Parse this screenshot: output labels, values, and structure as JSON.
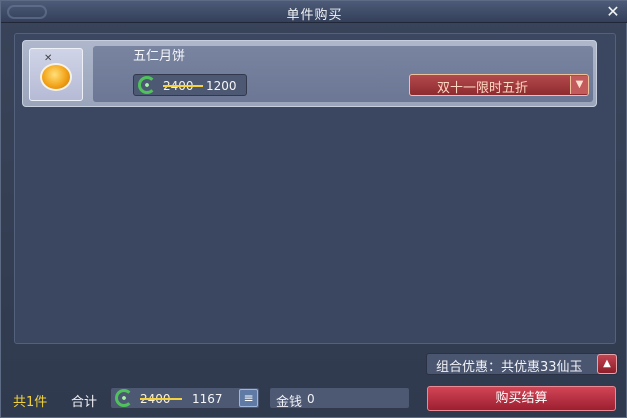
{
  "window": {
    "title": "单件购买"
  },
  "item": {
    "name": "五仁月饼",
    "icon": "mooncake-icon",
    "currency_icon": "jade-icon",
    "original_price": "2400",
    "sale_price": "1200",
    "promo_label": "双十一限时五折"
  },
  "combo": {
    "label": "组合优惠：共优惠33仙玉"
  },
  "footer": {
    "count_label": "共1件",
    "total_label": "合计",
    "total_original": "2400",
    "total_value": "1167",
    "money_label": "金钱",
    "money_value": "0",
    "checkout_label": "购买结算"
  },
  "colors": {
    "accent_red": "#b8333f",
    "count_yellow": "#f2d23a",
    "strike_yellow": "#f6d23c",
    "jade_green": "#4fc25c"
  }
}
